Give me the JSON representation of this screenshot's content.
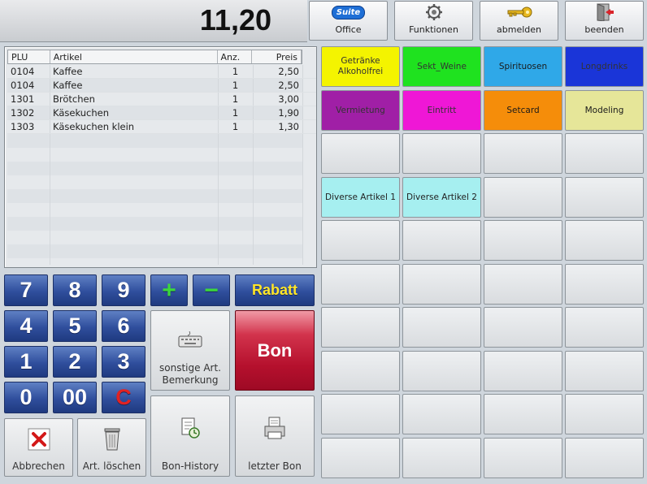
{
  "total": "11,20",
  "top_buttons": [
    {
      "label": "Office",
      "icon": "suite-logo-icon",
      "icon_text": "Suite"
    },
    {
      "label": "Funktionen",
      "icon": "gear-icon"
    },
    {
      "label": "abmelden",
      "icon": "key-icon"
    },
    {
      "label": "beenden",
      "icon": "exit-door-icon"
    }
  ],
  "receipt": {
    "headers": {
      "plu": "PLU",
      "artikel": "Artikel",
      "anz": "Anz.",
      "preis": "Preis"
    },
    "rows": [
      {
        "plu": "0104",
        "artikel": "Kaffee",
        "anz": "1",
        "preis": "2,50"
      },
      {
        "plu": "0104",
        "artikel": "Kaffee",
        "anz": "1",
        "preis": "2,50"
      },
      {
        "plu": "1301",
        "artikel": "Brötchen",
        "anz": "1",
        "preis": "3,00"
      },
      {
        "plu": "1302",
        "artikel": "Käsekuchen",
        "anz": "1",
        "preis": "1,90"
      },
      {
        "plu": "1303",
        "artikel": "Käsekuchen klein",
        "anz": "1",
        "preis": "1,30"
      }
    ]
  },
  "keypad": {
    "k7": "7",
    "k8": "8",
    "k9": "9",
    "k4": "4",
    "k5": "5",
    "k6": "6",
    "k1": "1",
    "k2": "2",
    "k3": "3",
    "k0": "0",
    "k00": "00",
    "clear": "C",
    "plus": "+",
    "minus": "−",
    "rabatt": "Rabatt"
  },
  "actions": {
    "sonstige_line1": "sonstige Art.",
    "sonstige_line2": "Bemerkung",
    "bon": "Bon",
    "abbrechen": "Abbrechen",
    "art_loeschen": "Art. löschen",
    "bon_history": "Bon-History",
    "letzter_bon": "letzter Bon"
  },
  "categories": [
    {
      "label": "Getränke Alkoholfrei",
      "color": "#f4f400",
      "text_color": "#333333"
    },
    {
      "label": "Sekt_Weine",
      "color": "#1fe21f",
      "text_color": "#333333"
    },
    {
      "label": "Spirituosen",
      "color": "#2fa8e8",
      "text_color": "#1a1a1a"
    },
    {
      "label": "Longdrinks",
      "color": "#1a35d8",
      "text_color": "#333333"
    },
    {
      "label": "Vermietung",
      "color": "#a01fa6",
      "text_color": "#333333"
    },
    {
      "label": "Eintritt",
      "color": "#ef17d6",
      "text_color": "#333333"
    },
    {
      "label": "Setcard",
      "color": "#f58d0a",
      "text_color": "#1a1a1a"
    },
    {
      "label": "Modeling",
      "color": "#e6e699",
      "text_color": "#1a1a1a"
    }
  ],
  "articles": [
    {
      "label": "Diverse Artikel 1",
      "color": "#a6eff0"
    },
    {
      "label": "Diverse Artikel 2",
      "color": "#a6eff0"
    }
  ]
}
